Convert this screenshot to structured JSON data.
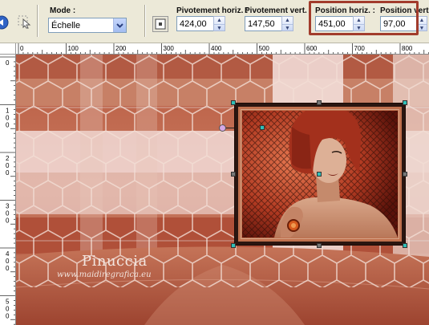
{
  "toolbar": {
    "mode_label": "Mode :",
    "mode_value": "Échelle",
    "pivot_h_label": "Pivotement horiz. :",
    "pivot_h_value": "424,00",
    "pivot_v_label": "Pivotement vert. :",
    "pivot_v_value": "147,50",
    "pos_h_label": "Position horiz. :",
    "pos_h_value": "451,00",
    "pos_v_label": "Position vert. :",
    "pos_v_value": "97,00"
  },
  "ruler": {
    "h_labels": [
      "0",
      "100",
      "200",
      "300",
      "400",
      "500",
      "600",
      "700",
      "800"
    ],
    "v_labels": [
      "0",
      "100",
      "200",
      "300",
      "400",
      "500"
    ]
  },
  "watermark": {
    "name": "Pinuccia",
    "url": "www.maidiregrafica.eu"
  },
  "colors": {
    "highlight": "#a23c2c",
    "canvas_rust": "#b0563e",
    "handle_teal": "#30c0b8"
  },
  "icons": {
    "undo": "undo-icon",
    "pick": "pick-tool-icon",
    "anchor": "anchor-icon",
    "dropdown": "chevron-down-icon"
  }
}
